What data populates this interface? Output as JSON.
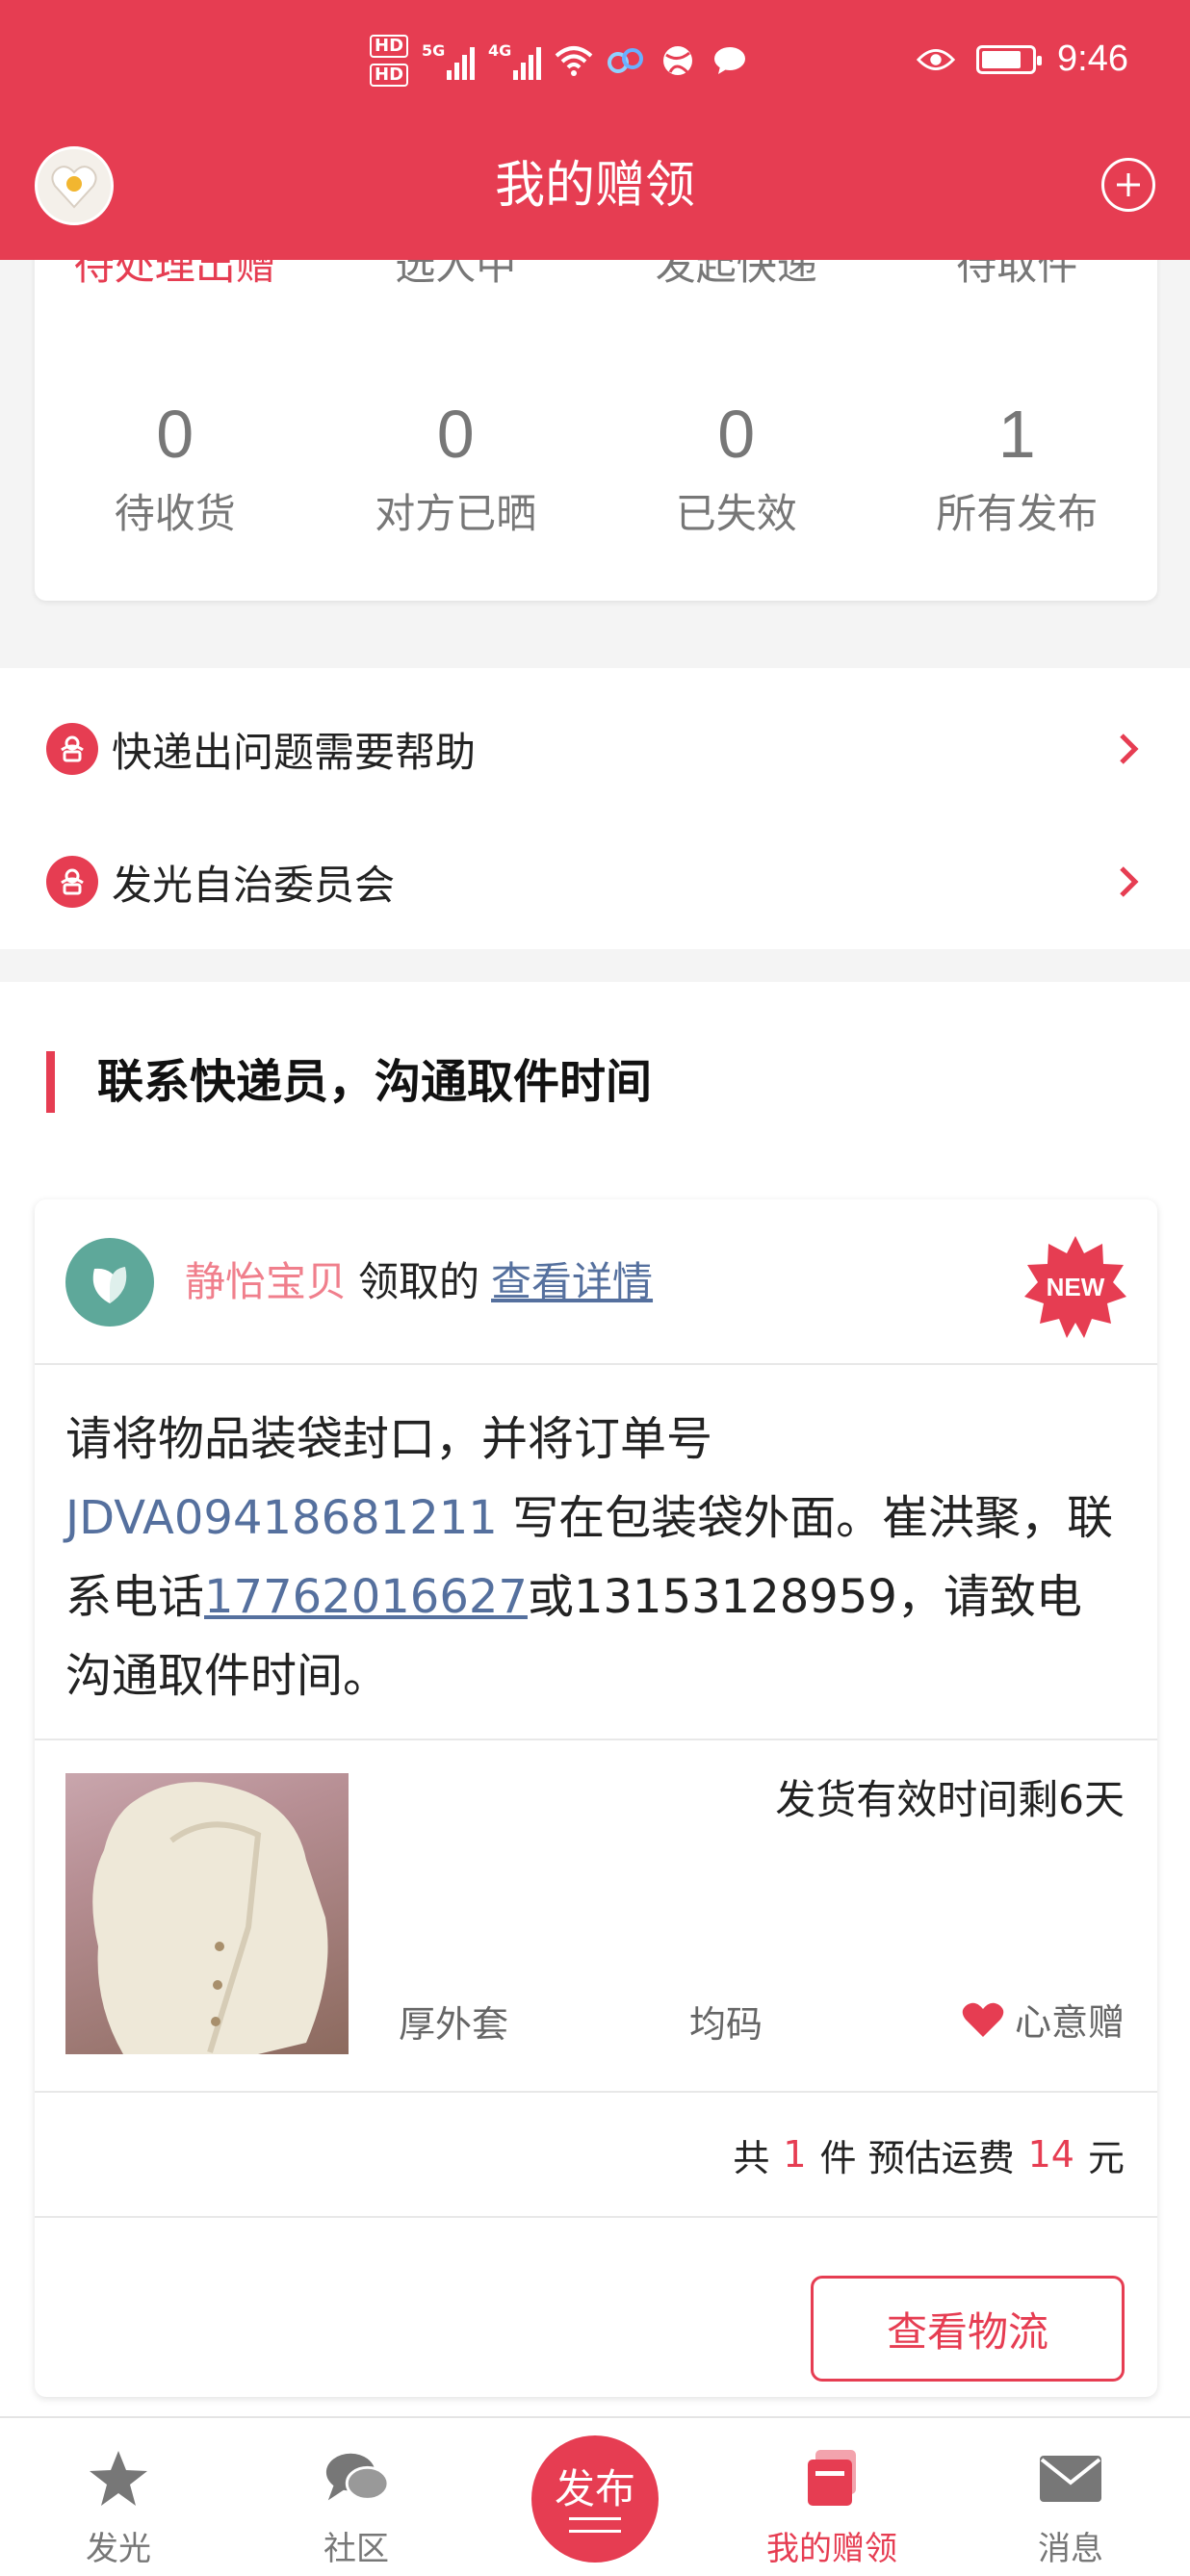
{
  "status_bar": {
    "hd_labels": [
      "HD",
      "HD"
    ],
    "network_1": "5G",
    "network_2": "4G",
    "time": "9:46"
  },
  "nav": {
    "title": "我的赠领"
  },
  "stats": {
    "top_tabs": [
      "待处理出赠",
      "选人中",
      "发起快递",
      "待取件"
    ],
    "items": [
      {
        "count": "0",
        "label": "待收货"
      },
      {
        "count": "0",
        "label": "对方已晒"
      },
      {
        "count": "0",
        "label": "已失效"
      },
      {
        "count": "1",
        "label": "所有发布"
      }
    ]
  },
  "menu": {
    "items": [
      {
        "label": "快递出问题需要帮助"
      },
      {
        "label": "发光自治委员会"
      }
    ]
  },
  "section": {
    "title": "联系快递员，沟通取件时间"
  },
  "order": {
    "receiver_name": "静怡宝贝",
    "receiver_action": "领取的",
    "detail_link": "查看详情",
    "badge": "NEW",
    "message": {
      "part1": "请将物品装袋封口，并将订单号 ",
      "order_code": "JDVA09418681211",
      "part2": " 写在包装袋外面。崔洪聚，联系电话",
      "phone_1": "17762016627",
      "part3": "或13153128959，请致电沟通取件时间。"
    },
    "deadline": "发货有效时间剩6天",
    "item_type": "厚外套",
    "item_size": "均码",
    "gift_type": "心意赠",
    "summary": {
      "prefix": "共",
      "count": "1",
      "unit": "件 预估运费",
      "fee": "14",
      "currency": "元"
    },
    "logistics_button": "查看物流"
  },
  "tabbar": {
    "tabs": [
      {
        "label": "发光",
        "icon": "star-icon"
      },
      {
        "label": "社区",
        "icon": "chat-bubble-icon"
      },
      {
        "label": "发布",
        "icon": "publish-icon"
      },
      {
        "label": "我的赠领",
        "icon": "gift-book-icon"
      },
      {
        "label": "消息",
        "icon": "mail-icon"
      }
    ],
    "active_index": 3
  },
  "colors": {
    "brand_red": "#e63d52",
    "link_blue": "#55709e",
    "receiver_pink": "#f07f8c"
  }
}
